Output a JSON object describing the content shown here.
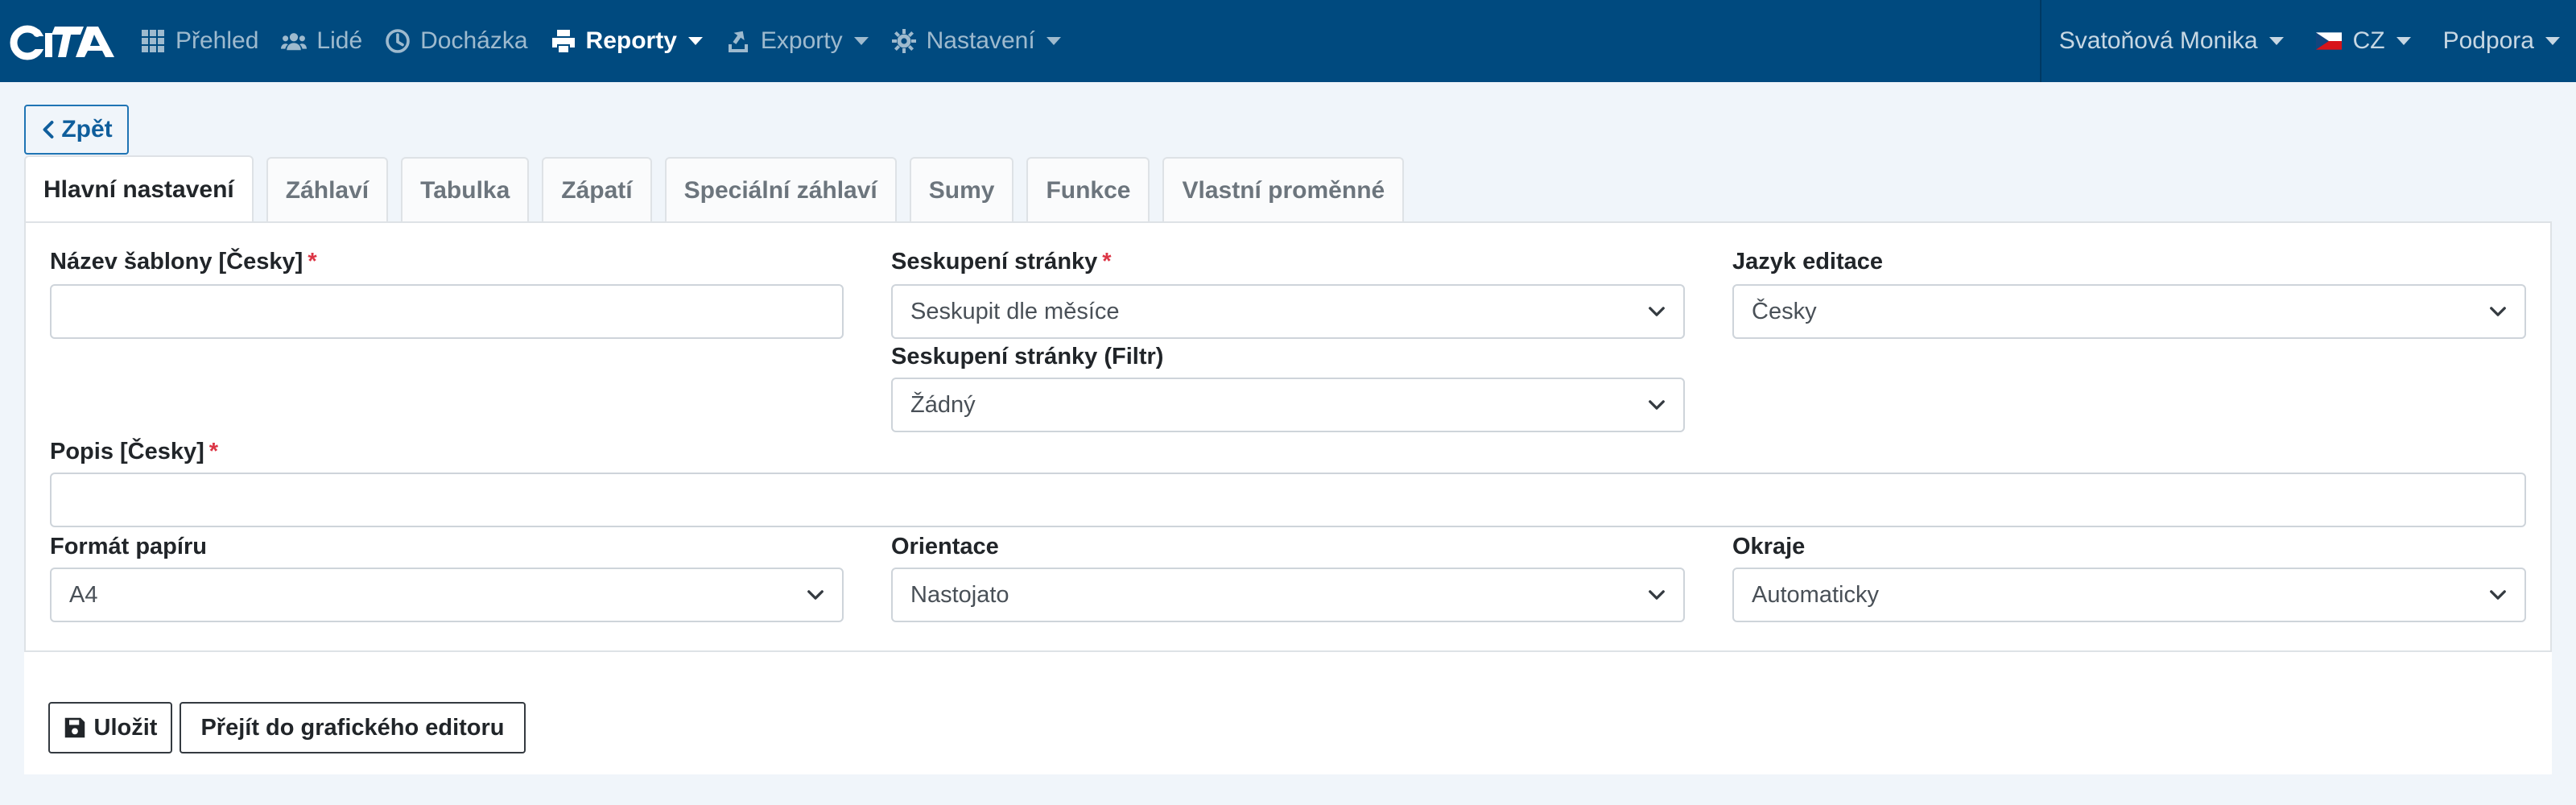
{
  "nav": {
    "items": [
      {
        "label": "Přehled",
        "icon": "grid-icon"
      },
      {
        "label": "Lidé",
        "icon": "users-icon"
      },
      {
        "label": "Docházka",
        "icon": "clock-icon"
      },
      {
        "label": "Reporty",
        "icon": "print-icon"
      },
      {
        "label": "Exporty",
        "icon": "export-icon"
      },
      {
        "label": "Nastavení",
        "icon": "gear-icon"
      }
    ],
    "user": "Svatoňová Monika",
    "language": "CZ",
    "support": "Podpora"
  },
  "back_label": "Zpět",
  "tabs": [
    "Hlavní nastavení",
    "Záhlaví",
    "Tabulka",
    "Zápatí",
    "Speciální záhlaví",
    "Sumy",
    "Funkce",
    "Vlastní proměnné"
  ],
  "form": {
    "template_name": {
      "label": "Název šablony [Česky]",
      "required_mark": "*",
      "value": ""
    },
    "page_grouping": {
      "label": "Seskupení stránky",
      "required_mark": "*",
      "value": "Seskupit dle měsíce"
    },
    "edit_language": {
      "label": "Jazyk editace",
      "value": "Česky"
    },
    "page_grouping_filter": {
      "label": "Seskupení stránky (Filtr)",
      "value": "Žádný"
    },
    "description": {
      "label": "Popis [Česky]",
      "required_mark": "*",
      "value": ""
    },
    "paper_format": {
      "label": "Formát papíru",
      "value": "A4"
    },
    "orientation": {
      "label": "Orientace",
      "value": "Nastojato"
    },
    "margins": {
      "label": "Okraje",
      "value": "Automaticky"
    }
  },
  "actions": {
    "save_label": "Uložit",
    "graphic_editor_label": "Přejít do grafického editoru"
  },
  "colors": {
    "navbar": "#004a7f",
    "page_background": "#f0f5fa",
    "required": "#dc3545",
    "link": "#0f5e9c"
  }
}
